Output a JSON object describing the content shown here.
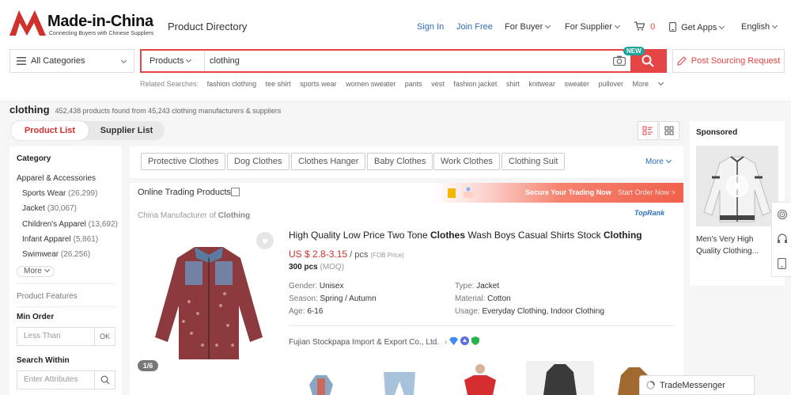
{
  "header": {
    "brand": "Made-in-China",
    "tagline": "Connecting Buyers with Chinese Suppliers",
    "section_title": "Product Directory",
    "nav": {
      "sign_in": "Sign In",
      "join_free": "Join Free",
      "for_buyer": "For Buyer",
      "for_supplier": "For Supplier",
      "cart_count": "0",
      "get_apps": "Get Apps",
      "language": "English"
    }
  },
  "search": {
    "category_label": "All Categories",
    "scope_label": "Products",
    "query": "clothing",
    "new_badge": "NEW",
    "post_sourcing_label": "Post Sourcing Request"
  },
  "related": {
    "label": "Related Searches:",
    "items": [
      "fashion clothing",
      "tee shirt",
      "sports wear",
      "women sweater",
      "pants",
      "vest",
      "fashion jacket",
      "shirt",
      "knitwear",
      "sweater",
      "pullover"
    ],
    "more": "More"
  },
  "results": {
    "query": "clothing",
    "summary": "452,438 products found from 45,243  clothing manufacturers & suppliers"
  },
  "tabs": {
    "product_list": "Product List",
    "supplier_list": "Supplier List"
  },
  "filters": {
    "category_heading": "Category",
    "parent": "Apparel & Accessories",
    "items": [
      {
        "label": "Sports Wear",
        "count": "(26,299)"
      },
      {
        "label": "Jacket",
        "count": "(30,067)"
      },
      {
        "label": "Children's Apparel",
        "count": "(13,692)"
      },
      {
        "label": "Infant Apparel",
        "count": "(5,861)"
      },
      {
        "label": "Swimwear",
        "count": "(26,256)"
      }
    ],
    "more": "More",
    "product_features": "Product Features",
    "min_order_heading": "Min Order",
    "min_order_placeholder": "Less Than",
    "ok": "OK",
    "search_within_heading": "Search Within",
    "attributes_placeholder": "Enter Attributes"
  },
  "chips": {
    "items": [
      "Protective Clothes",
      "Dog Clothes",
      "Clothes Hanger",
      "Baby Clothes",
      "Work Clothes",
      "Clothing Suit"
    ],
    "more": "More"
  },
  "banner": {
    "online_trading": "Online Trading Products",
    "secure": "Secure Your Trading Now",
    "start_order": "Start Order Now >"
  },
  "product": {
    "manufacturer_prefix": "China Manufacturer of ",
    "manufacturer_keyword": "Clothing",
    "rank_badge": "TopRank",
    "title_parts": [
      "High Quality Low Price Two Tone ",
      "Clothes",
      " Wash Boys Casual Shirts Stock ",
      "Clothing"
    ],
    "price": "US $ 2.8-3.15",
    "price_unit": " / pcs ",
    "price_term": "(FOB Price)",
    "moq_value": "300 pcs",
    "moq_label": "(MOQ)",
    "attributes": [
      {
        "label": "Gender: ",
        "value": "Unisex"
      },
      {
        "label": "Season: ",
        "value": "Spring / Autumn"
      },
      {
        "label": "Age: ",
        "value": "6-16"
      },
      {
        "label": "Type: ",
        "value": "Jacket"
      },
      {
        "label": "Material: ",
        "value": "Cotton"
      },
      {
        "label": "Usage: ",
        "value": "Everyday Clothing, Indoor Clothing"
      }
    ],
    "supplier": "Fujian Stockpapa Import & Export Co., Ltd.",
    "image_counter": "1/6"
  },
  "sponsored": {
    "heading": "Sponsored",
    "title": "Men's Very High Quality Clothing..."
  },
  "messenger": {
    "label": "TradeMessenger"
  },
  "colors": {
    "brand_red": "#e64545",
    "link_blue": "#2d6cc0",
    "price_red": "#d0312d"
  }
}
